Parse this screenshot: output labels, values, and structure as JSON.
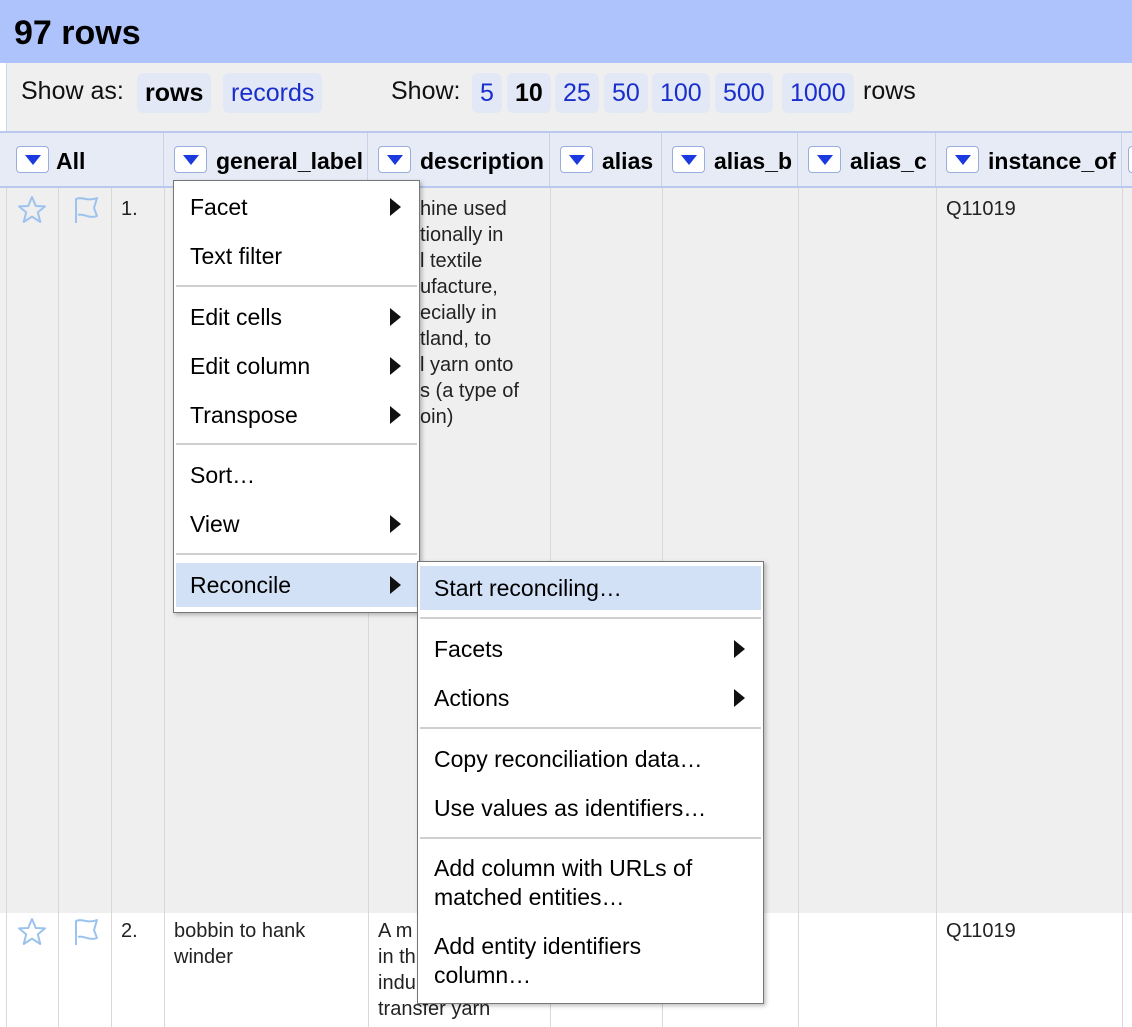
{
  "header": {
    "title": "97 rows"
  },
  "controls": {
    "show_as_label": "Show as:",
    "show_as_options": [
      "rows",
      "records"
    ],
    "show_as_selected": "rows",
    "show_label": "Show:",
    "page_sizes": [
      "5",
      "10",
      "25",
      "50",
      "100",
      "500",
      "1000"
    ],
    "page_size_selected": "10",
    "rows_suffix": "rows"
  },
  "columns": [
    "All",
    "general_label",
    "description",
    "alias",
    "alias_b",
    "alias_c",
    "instance_of"
  ],
  "rows": [
    {
      "index": "1.",
      "general_label": "",
      "description_lines": [
        "hine used",
        "tionally in",
        "l textile",
        "ufacture,",
        "ecially in",
        "tland, to",
        "l yarn onto",
        "s (a type of",
        "oin)"
      ],
      "instance_of": "Q11019"
    },
    {
      "index": "2.",
      "general_label_lines": [
        "bobbin to hank",
        "winder"
      ],
      "description_lines": [
        "A m",
        "in th",
        "indu",
        "transfer yarn"
      ],
      "instance_of": "Q11019"
    }
  ],
  "column_menu": {
    "items": [
      {
        "label": "Facet",
        "submenu": true
      },
      {
        "label": "Text filter",
        "submenu": false
      },
      {
        "label": "Edit cells",
        "submenu": true
      },
      {
        "label": "Edit column",
        "submenu": true
      },
      {
        "label": "Transpose",
        "submenu": true
      },
      {
        "label": "Sort…",
        "submenu": false
      },
      {
        "label": "View",
        "submenu": true
      },
      {
        "label": "Reconcile",
        "submenu": true
      }
    ]
  },
  "reconcile_menu": {
    "items": [
      {
        "label": "Start reconciling…"
      },
      {
        "label": "Facets"
      },
      {
        "label": "Actions"
      },
      {
        "label": "Copy reconciliation data…"
      },
      {
        "label": "Use values as identifiers…"
      },
      {
        "label_lines": [
          "Add column with URLs of",
          "matched entities…"
        ]
      },
      {
        "label_lines": [
          "Add entity identifiers",
          "column…"
        ]
      }
    ]
  },
  "colors": {
    "header_bg": "#aec3fb",
    "link": "#1a2ecc",
    "menu_highlight": "#d3e1f6",
    "dropdown_arrow": "#1a3adf"
  }
}
